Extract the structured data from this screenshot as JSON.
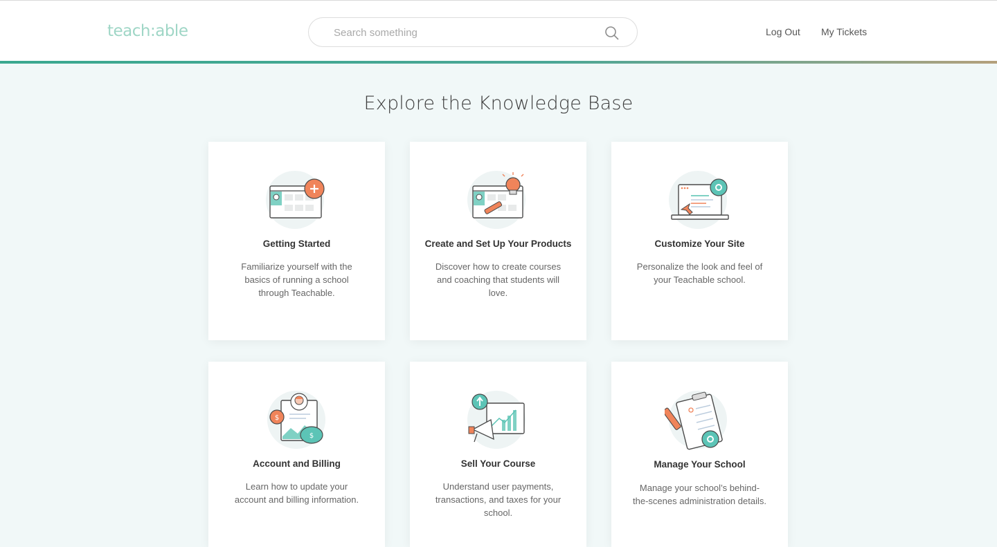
{
  "header": {
    "logo_text": "teach:able",
    "search_placeholder": "Search something",
    "nav": {
      "logout": "Log Out",
      "tickets": "My Tickets"
    }
  },
  "main": {
    "title": "Explore the Knowledge Base",
    "cards": [
      {
        "title": "Getting Started",
        "description": "Familiarize yourself with the basics of running a school through Teachable.",
        "icon": "dashboard-add-icon"
      },
      {
        "title": "Create and Set Up Your Products",
        "description": "Discover how to create courses and coaching that students will love.",
        "icon": "dashboard-lightbulb-icon"
      },
      {
        "title": "Customize Your Site",
        "description": "Personalize the look and feel of your Teachable school.",
        "icon": "laptop-gear-icon"
      },
      {
        "title": "Account and Billing",
        "description": "Learn how to update your account and billing information.",
        "icon": "billing-money-icon"
      },
      {
        "title": "Sell Your Course",
        "description": "Understand user payments, transactions, and taxes for your school.",
        "icon": "megaphone-chart-icon"
      },
      {
        "title": "Manage Your School",
        "description": "Manage your school’s behind-the-scenes administration details.",
        "icon": "clipboard-gear-icon"
      }
    ]
  },
  "colors": {
    "accent_orange": "#f0845a",
    "accent_teal": "#5cc4b6",
    "logo": "#9fd6c6",
    "background": "#f1f8f8"
  }
}
